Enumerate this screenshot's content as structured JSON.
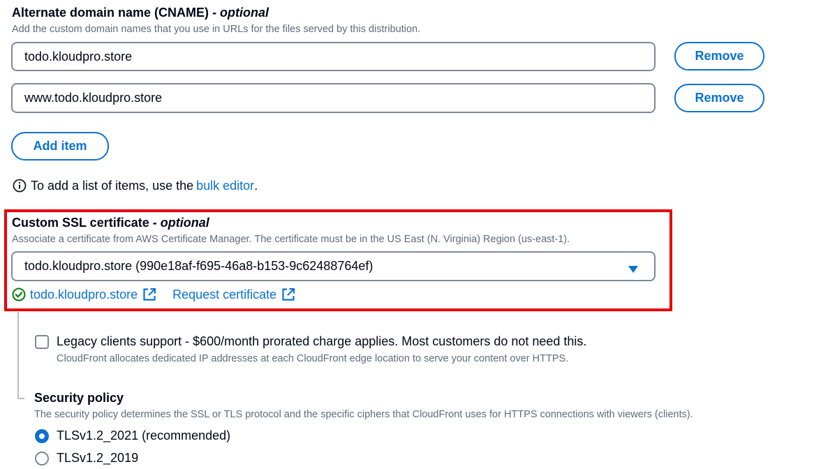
{
  "cname": {
    "title": "Alternate domain name (CNAME)",
    "optional": "- optional",
    "description": "Add the custom domain names that you use in URLs for the files served by this distribution.",
    "items": [
      {
        "value": "todo.kloudpro.store",
        "remove_label": "Remove"
      },
      {
        "value": "www.todo.kloudpro.store",
        "remove_label": "Remove"
      }
    ],
    "add_item_label": "Add item",
    "bulk_hint_prefix": "To add a list of items, use the ",
    "bulk_editor_link": "bulk editor",
    "bulk_hint_suffix": "."
  },
  "ssl": {
    "title": "Custom SSL certificate",
    "optional": "- optional",
    "description": "Associate a certificate from AWS Certificate Manager. The certificate must be in the US East (N. Virginia) Region (us-east-1).",
    "selected_certificate": "todo.kloudpro.store (990e18af-f695-46a8-b153-9c62488764ef)",
    "cert_link": "todo.kloudpro.store",
    "request_link": "Request certificate",
    "highlight_color": "#e8000b"
  },
  "legacy": {
    "label": "Legacy clients support - $600/month prorated charge applies. Most customers do not need this.",
    "description": "CloudFront allocates dedicated IP addresses at each CloudFront edge location to serve your content over HTTPS.",
    "checked": false
  },
  "security_policy": {
    "title": "Security policy",
    "description": "The security policy determines the SSL or TLS protocol and the specific ciphers that CloudFront uses for HTTPS connections with viewers (clients).",
    "options": [
      {
        "label": "TLSv1.2_2021 (recommended)",
        "selected": true
      },
      {
        "label": "TLSv1.2_2019",
        "selected": false
      }
    ]
  },
  "colors": {
    "link": "#0972d3",
    "success": "#037f0c",
    "text": "#000716",
    "secondary_text": "#5f6b7a"
  }
}
